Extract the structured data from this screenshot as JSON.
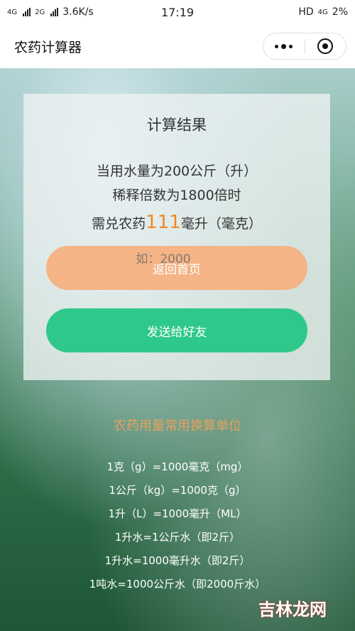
{
  "status_bar": {
    "net1": "4G",
    "net2": "2G",
    "speed": "3.6K/s",
    "time": "17:19",
    "hd": "HD",
    "net3": "4G",
    "battery": "2%"
  },
  "nav": {
    "title": "农药计算器"
  },
  "result": {
    "title": "计算结果",
    "line1": "当用水量为200公斤（升）",
    "line2": "稀释倍数为1800倍时",
    "line3_prefix": "需兑农药",
    "line3_value": "111",
    "line3_suffix": "毫升（毫克）",
    "placeholder": "如：2000",
    "home_button": "返回首页",
    "send_button": "发送给好友"
  },
  "units": {
    "title": "农药用量常用换算单位",
    "items": [
      "1克（g）=1000毫克（mg）",
      "1公斤（kg）=1000克（g）",
      "1升（L）=1000毫升（ML）",
      "1升水=1公斤水（即2斤）",
      "1升水=1000毫升水（即2斤）",
      "1吨水=1000公斤水（即2000斤水）"
    ]
  },
  "watermark": "吉林龙网",
  "colors": {
    "accent_orange": "#f08a24",
    "home_button": "#f4b486",
    "send_button": "#2ec98a",
    "units_title": "#e8a05a"
  }
}
